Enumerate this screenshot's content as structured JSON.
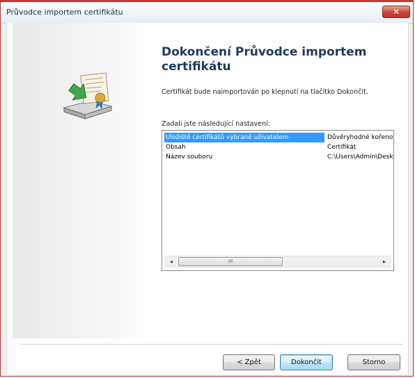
{
  "window": {
    "title": "Průvodce importem certifikátu",
    "close_symbol": "✕"
  },
  "icons": {
    "certificate": "certificate-import-icon"
  },
  "main": {
    "heading": "Dokončení Průvodce importem certifikátu",
    "description": "Certifikát bude naimportován po klepnutí na tlačítko Dokončit.",
    "settings_label": "Zadali jste následující nastavení:",
    "settings": [
      {
        "name": "Uložiště certifikátů vybrané uživatelem",
        "value": "Důvěryhodné kořenové",
        "selected": true
      },
      {
        "name": "Obsah",
        "value": "Certifikát",
        "selected": false
      },
      {
        "name": "Název souboru",
        "value": "C:\\Users\\Admin\\Desktop",
        "selected": false
      }
    ],
    "scroll_thumb_glyph": "III",
    "scroll_left": "◂",
    "scroll_right": "▸"
  },
  "buttons": {
    "back": "< Zpět",
    "finish": "Dokončit",
    "cancel": "Storno"
  },
  "colors": {
    "selection": "#3399ff",
    "heading": "#1e3a5f",
    "close_button": "#c6463a"
  }
}
